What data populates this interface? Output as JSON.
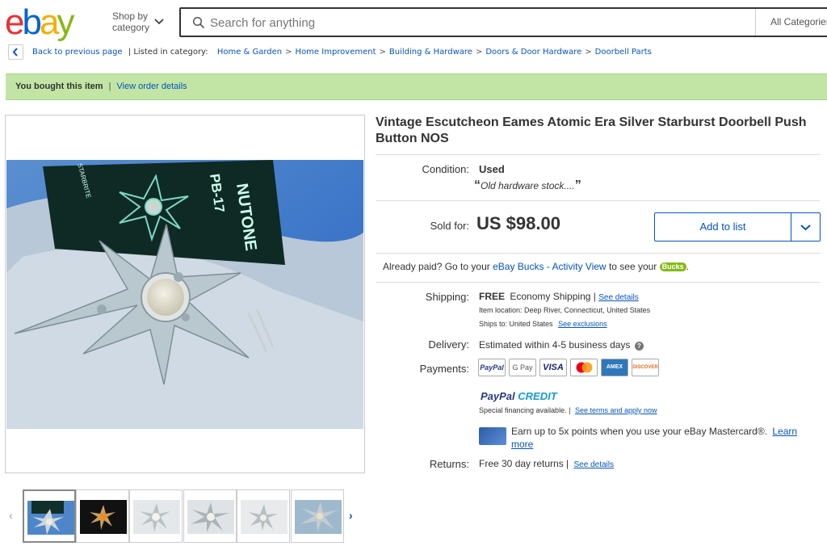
{
  "header": {
    "logo": {
      "e": "e",
      "b": "b",
      "a": "a",
      "y": "y"
    },
    "shop_by_line1": "Shop by",
    "shop_by_line2": "category",
    "search_placeholder": "Search for anything",
    "search_category": "All Categories"
  },
  "breadcrumb": {
    "back_label": "Back to previous page",
    "listed_in": "| Listed in category:",
    "items": [
      "Home & Garden",
      "Home Improvement",
      "Building & Hardware",
      "Doors & Door Hardware",
      "Doorbell Parts"
    ],
    "separator": ">"
  },
  "banner": {
    "bought": "You bought this item",
    "separator": "|",
    "view_order": "View order details"
  },
  "listing": {
    "title": "Vintage Escutcheon Eames Atomic Era Silver Starburst Doorbell Push Button NOS",
    "condition_label": "Condition:",
    "condition_value": "Used",
    "condition_note": "Old hardware stock....",
    "sold_label": "Sold for:",
    "price": "US $98.00",
    "add_to_list": "Add to list",
    "already_paid_prefix": "Already paid? Go to your",
    "bucks_link": "eBay Bucks - Activity View",
    "already_paid_suffix": "to see your",
    "bucks_badge": "Bucks",
    "period": "."
  },
  "shipping": {
    "label": "Shipping:",
    "free": "FREE",
    "method": "Economy Shipping |",
    "see_details": "See details",
    "location": "Item location:  Deep River, Connecticut, United States",
    "ships_to": "Ships to:  United States",
    "see_exclusions": "See exclusions"
  },
  "delivery": {
    "label": "Delivery:",
    "text": "Estimated within 4-5 business days",
    "info": "?"
  },
  "payments": {
    "label": "Payments:",
    "methods": [
      "PayPal",
      "G Pay",
      "VISA",
      "Mastercard",
      "AMEX",
      "DISCOVER"
    ],
    "paypal_credit_1": "PayPal",
    "paypal_credit_2": "CREDIT",
    "financing": "Special financing available.  |",
    "terms_link": "See terms and apply now",
    "mastercard_text": "Earn up to 5x points when you use your eBay Mastercard®.",
    "learn_more": "Learn more"
  },
  "returns": {
    "label": "Returns:",
    "text": "Free 30 day returns |",
    "see_details": "See details"
  },
  "gallery": {
    "prev": "‹",
    "next": "›",
    "box_text": "NUTONE",
    "model_text": "PB-17",
    "side_text": "STARBRITE"
  },
  "colors": {
    "banner_bg": "#c2e5a5",
    "link": "#0654ba",
    "ebay_red": "#e53238",
    "ebay_blue": "#0064d2",
    "ebay_yellow": "#f5af02",
    "ebay_green": "#86b817"
  }
}
